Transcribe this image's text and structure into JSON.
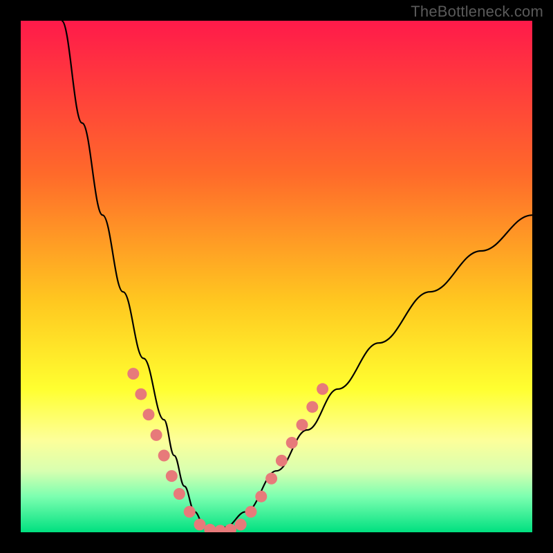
{
  "watermark": "TheBottleneck.com",
  "chart_data": {
    "type": "line",
    "title": "",
    "xlabel": "",
    "ylabel": "",
    "xlim": [
      0,
      100
    ],
    "ylim": [
      0,
      100
    ],
    "gradient_stops": [
      {
        "offset": 0,
        "color": "#ff1a4a"
      },
      {
        "offset": 30,
        "color": "#ff6a2a"
      },
      {
        "offset": 55,
        "color": "#ffc820"
      },
      {
        "offset": 72,
        "color": "#ffff30"
      },
      {
        "offset": 82,
        "color": "#fdff9a"
      },
      {
        "offset": 88,
        "color": "#d8ffb0"
      },
      {
        "offset": 93,
        "color": "#7cffb0"
      },
      {
        "offset": 100,
        "color": "#00e080"
      }
    ],
    "series": [
      {
        "name": "bottleneck-curve",
        "x": [
          8,
          12,
          16,
          20,
          24,
          28,
          30,
          32,
          34,
          36,
          38,
          40,
          44,
          50,
          56,
          62,
          70,
          80,
          90,
          100
        ],
        "values": [
          100,
          80,
          62,
          47,
          34,
          22,
          15,
          9,
          4,
          1,
          0,
          1,
          4,
          12,
          20,
          28,
          37,
          47,
          55,
          62
        ]
      }
    ],
    "markers": {
      "name": "highlight-dots",
      "color": "#e77a7a",
      "points": [
        {
          "x": 22,
          "y": 31
        },
        {
          "x": 23.5,
          "y": 27
        },
        {
          "x": 25,
          "y": 23
        },
        {
          "x": 26.5,
          "y": 19
        },
        {
          "x": 28,
          "y": 15
        },
        {
          "x": 29.5,
          "y": 11
        },
        {
          "x": 31,
          "y": 7.5
        },
        {
          "x": 33,
          "y": 4
        },
        {
          "x": 35,
          "y": 1.5
        },
        {
          "x": 37,
          "y": 0.5
        },
        {
          "x": 39,
          "y": 0.3
        },
        {
          "x": 41,
          "y": 0.5
        },
        {
          "x": 43,
          "y": 1.5
        },
        {
          "x": 45,
          "y": 4
        },
        {
          "x": 47,
          "y": 7
        },
        {
          "x": 49,
          "y": 10.5
        },
        {
          "x": 51,
          "y": 14
        },
        {
          "x": 53,
          "y": 17.5
        },
        {
          "x": 55,
          "y": 21
        },
        {
          "x": 57,
          "y": 24.5
        },
        {
          "x": 59,
          "y": 28
        }
      ]
    }
  }
}
